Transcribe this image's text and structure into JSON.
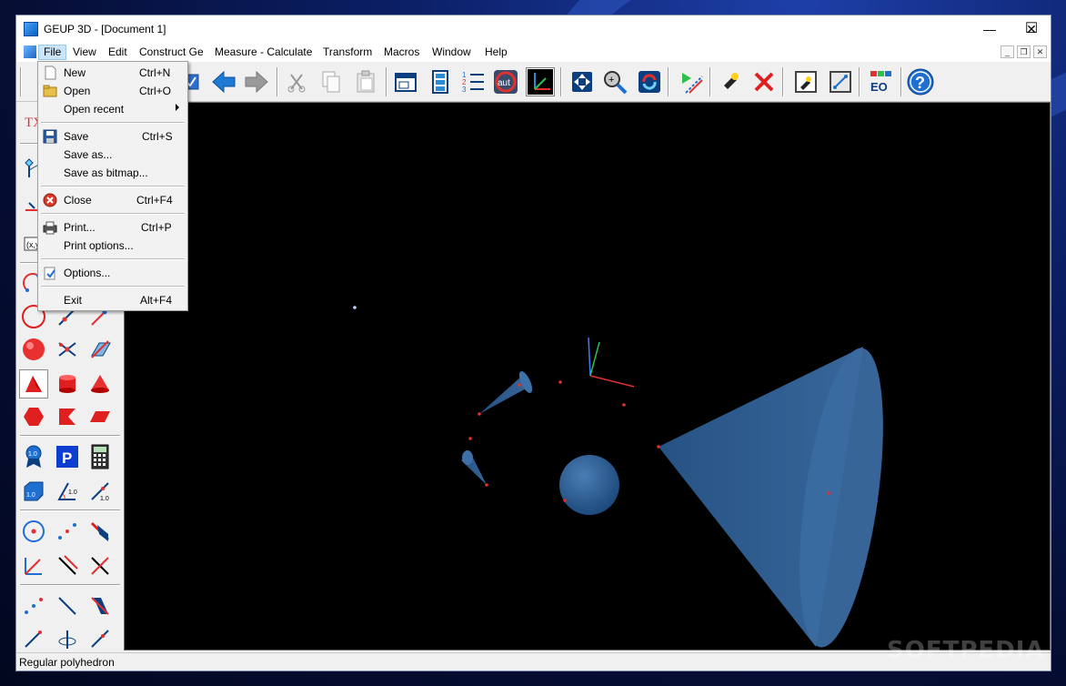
{
  "window": {
    "title": "GEUP 3D - [Document 1]",
    "minimize": "—",
    "maximize": "☐",
    "close": "✕"
  },
  "menubar": {
    "items": [
      "File",
      "View",
      "Edit",
      "Construct Ge",
      "Measure - Calculate",
      "Transform",
      "Macros",
      "Window",
      "Help"
    ],
    "active": "File"
  },
  "file_menu": {
    "items": [
      {
        "label": "New",
        "shortcut": "Ctrl+N",
        "icon": "new-document-icon"
      },
      {
        "label": "Open",
        "shortcut": "Ctrl+O",
        "icon": "open-folder-icon"
      },
      {
        "label": "Open recent",
        "shortcut": "",
        "icon": "",
        "submenu": true
      },
      {
        "label": "Save",
        "shortcut": "Ctrl+S",
        "icon": "save-disk-icon"
      },
      {
        "label": "Save as...",
        "shortcut": "",
        "icon": ""
      },
      {
        "label": "Save as bitmap...",
        "shortcut": "",
        "icon": ""
      },
      {
        "label": "Close",
        "shortcut": "Ctrl+F4",
        "icon": "close-circle-icon"
      },
      {
        "label": "Print...",
        "shortcut": "Ctrl+P",
        "icon": "printer-icon"
      },
      {
        "label": "Print options...",
        "shortcut": "",
        "icon": ""
      },
      {
        "label": "Options...",
        "shortcut": "",
        "icon": "options-icon"
      },
      {
        "label": "Exit",
        "shortcut": "Alt+F4",
        "icon": ""
      }
    ]
  },
  "toolbar": {
    "auto_label": "aut",
    "eo_label": "EO",
    "help_label": "?"
  },
  "left_toolbar": {
    "text_tool_label": "TX",
    "badge_label": "1.0",
    "p_label": "P"
  },
  "statusbar": {
    "text": "Regular polyhedron"
  },
  "watermark": "SOFTPEDIA",
  "colors": {
    "accent_blue": "#1f6fd1",
    "shape_blue": "#2a5a8f",
    "point_red": "#e03030",
    "viewport_bg": "#000000"
  }
}
